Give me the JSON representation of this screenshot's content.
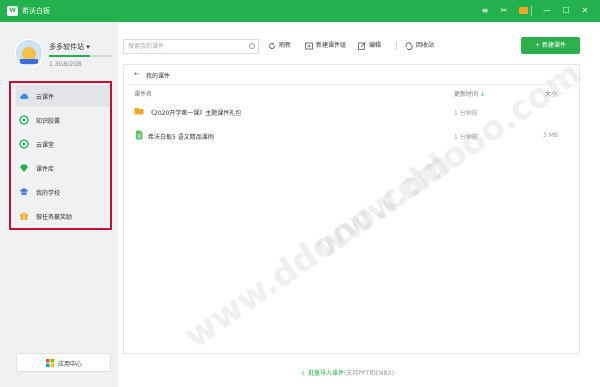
{
  "app": {
    "title": "希沃白板"
  },
  "user": {
    "name": "多多软件站",
    "storage": "1.3GB/2GB",
    "storage_fraction": 0.65
  },
  "sidebar": {
    "items": [
      {
        "label": "云课件",
        "icon": "cloud-icon",
        "color": "#3a8ee6",
        "active": true
      },
      {
        "label": "知识胶囊",
        "icon": "capsule-icon",
        "color": "#22b14c"
      },
      {
        "label": "云课堂",
        "icon": "classroom-icon",
        "color": "#22b14c"
      },
      {
        "label": "课件库",
        "icon": "diamond-icon",
        "color": "#22b14c"
      },
      {
        "label": "我的学校",
        "icon": "school-icon",
        "color": "#4c7bdc"
      },
      {
        "label": "做任务赢奖励",
        "icon": "gift-icon",
        "color": "#f5a623"
      }
    ],
    "app_center": "应用中心"
  },
  "toolbar": {
    "search_placeholder": "搜索我的课件",
    "refresh": "刷新",
    "new_group": "新建课件组",
    "edit": "编辑",
    "recycle": "回收站",
    "new_courseware": "+ 新建课件"
  },
  "main": {
    "breadcrumb": "我的课件",
    "columns": {
      "name": "课件名",
      "updated": "更新时间",
      "sort_arrow": "↓",
      "size": "大小"
    },
    "rows": [
      {
        "name": "《2020开学第一课》主题课件礼包",
        "time": "1 分钟前",
        "size": "",
        "icon": "folder-icon"
      },
      {
        "name": "希沃白板5 语文精品课例",
        "time": "1 分钟前",
        "size": "3 MB",
        "icon": "document-icon"
      }
    ],
    "import_label": "批量导入课件",
    "import_hint": "(支持PPT和ENBX)"
  },
  "watermark": "www.ddooo.com",
  "colors": {
    "brand": "#22b14c",
    "highlight": "#c8102e"
  }
}
